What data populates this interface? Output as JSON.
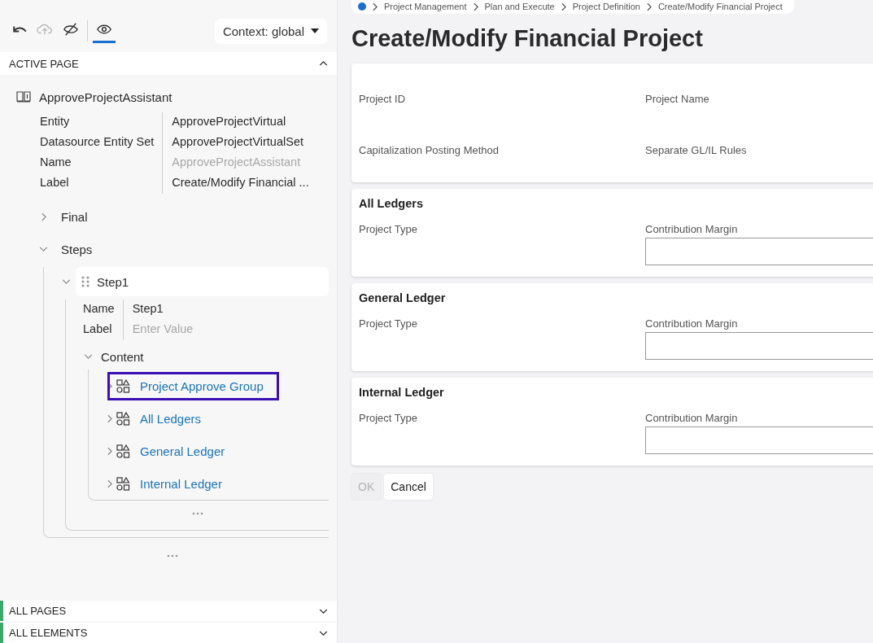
{
  "toolbar": {
    "tools": [
      {
        "kind": "undo",
        "disabled": false,
        "selected": false
      },
      {
        "kind": "upload",
        "disabled": true,
        "selected": false
      },
      {
        "kind": "hide",
        "disabled": false,
        "selected": false
      },
      {
        "kind": "preview",
        "disabled": false,
        "selected": true
      }
    ],
    "context": "Context: global"
  },
  "active_page": {
    "title": "ACTIVE PAGE",
    "expanded": true,
    "page": {
      "name": "ApproveProjectAssistant",
      "properties": [
        {
          "label": "Entity",
          "value": "ApproveProjectVirtual",
          "readonly": false
        },
        {
          "label": "Datasource Entity Set",
          "value": "ApproveProjectVirtualSet",
          "readonly": false
        },
        {
          "label": "Name",
          "value": "ApproveProjectAssistant",
          "readonly": true
        },
        {
          "label": "Label",
          "value": "Create/Modify Financial ...",
          "readonly": false
        }
      ]
    },
    "tree": [
      {
        "label": "Final",
        "expanded": false
      },
      {
        "label": "Steps",
        "expanded": true,
        "children": [
          {
            "label": "Step1",
            "expanded": true,
            "properties": [
              {
                "label": "Name",
                "value": "Step1"
              },
              {
                "label": "Label",
                "placeholder": "Enter Value"
              }
            ],
            "content": {
              "label": "Content",
              "expanded": true,
              "children": [
                {
                  "label": "Project Approve Group",
                  "selected": true
                },
                {
                  "label": "All Ledgers",
                  "selected": false
                },
                {
                  "label": "General Ledger",
                  "selected": false
                },
                {
                  "label": "Internal Ledger",
                  "selected": false
                }
              ]
            }
          }
        ]
      }
    ]
  },
  "sections": [
    {
      "title": "ALL PAGES",
      "expanded": false
    },
    {
      "title": "ALL ELEMENTS",
      "expanded": false
    }
  ],
  "main": {
    "breadcrumb": [
      "Project Management",
      "Plan and Execute",
      "Project Definition",
      "Create/Modify Financial Project"
    ],
    "title": "Create/Modify Financial Project",
    "cards": [
      {
        "fields": [
          {
            "label": "Project ID",
            "kind": "plain"
          },
          {
            "label": "Project Name",
            "kind": "plain"
          },
          {
            "label": "Capitalization Posting Method",
            "kind": "plain"
          },
          {
            "label": "Separate GL/IL Rules",
            "kind": "plain"
          }
        ]
      },
      {
        "title": "All Ledgers",
        "fields": [
          {
            "label": "Project Type",
            "kind": "plain"
          },
          {
            "label": "Contribution Margin",
            "kind": "input"
          }
        ]
      },
      {
        "title": "General Ledger",
        "fields": [
          {
            "label": "Project Type",
            "kind": "plain"
          },
          {
            "label": "Contribution Margin",
            "kind": "input"
          }
        ]
      },
      {
        "title": "Internal Ledger",
        "fields": [
          {
            "label": "Project Type",
            "kind": "plain"
          },
          {
            "label": "Contribution Margin",
            "kind": "input"
          }
        ]
      }
    ],
    "buttons": [
      {
        "label": "OK",
        "disabled": true
      },
      {
        "label": "Cancel",
        "disabled": false
      }
    ]
  }
}
